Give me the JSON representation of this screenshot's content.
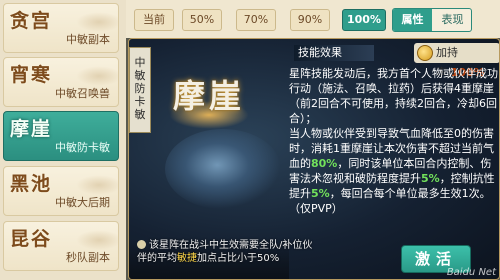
{
  "left_list": [
    {
      "name": "贪宫",
      "sub": "中敏副本",
      "selected": false
    },
    {
      "name": "宵寒",
      "sub": "中敏召唤兽",
      "selected": false
    },
    {
      "name": "摩崖",
      "sub": "中敏防卡敏",
      "selected": true
    },
    {
      "name": "黑池",
      "sub": "中敏大后期",
      "selected": false
    },
    {
      "name": "昆谷",
      "sub": "秒队副本",
      "selected": false
    }
  ],
  "top_tabs": {
    "percent_options": [
      "当前",
      "50%",
      "70%",
      "90%",
      "100%"
    ],
    "active_percent": "100%",
    "view_options": [
      "属性",
      "表现"
    ],
    "active_view": "属性"
  },
  "card": {
    "vertical_tag": [
      "中",
      "敏",
      "防",
      "卡",
      "敏"
    ],
    "formation_name": "摩崖",
    "skill_header": "技能效果",
    "chance_label": "加持率:",
    "chance_value": "100%",
    "description": {
      "para1": "星阵技能发动后，我方首个人物或伙伴成功行动（施法、召唤、拉药）后获得4重摩崖（前2回合不可使用，持续2回合，冷却6回合）；",
      "para2_a": "当人物或伙伴受到导致气血降低至0的伤害时，消耗1重摩崖让本次伤害不超过当前气血的",
      "para2_hl1": "80%",
      "para2_b": "，同时该单位本回合内控制、伤害法术忽视和破防程度提升",
      "para2_hl2": "5%",
      "para2_c": "，控制抗性提升",
      "para2_hl3": "5%",
      "para2_d": "，每回合每个单位最多生效1次。（仅PVP）"
    },
    "note_a": "该星阵在战斗中生效需要全队/补位伙伴的平均",
    "note_hl": "敏捷",
    "note_b": "加点占比小于50%",
    "activate_label": "激活"
  },
  "watermark": "Baidu Net",
  "colors": {
    "selected_teal": "#2f9e8c",
    "highlight_green": "#72e15b",
    "highlight_yellow": "#ffd84a",
    "chance_value": "#b5400c"
  }
}
